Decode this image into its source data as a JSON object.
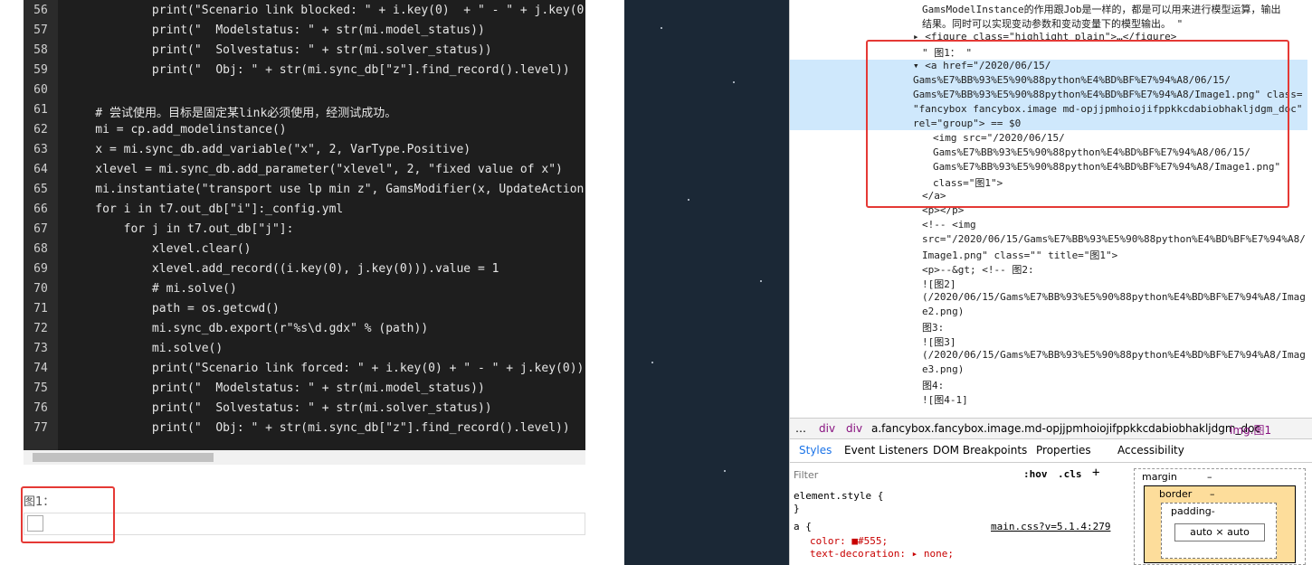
{
  "code": {
    "lines": [
      {
        "n": "56",
        "t": "            print(\"Scenario link blocked: \" + i.key(0)  + \" - \" + j.key(0"
      },
      {
        "n": "57",
        "t": "            print(\"  Modelstatus: \" + str(mi.model_status))"
      },
      {
        "n": "58",
        "t": "            print(\"  Solvestatus: \" + str(mi.solver_status))"
      },
      {
        "n": "59",
        "t": "            print(\"  Obj: \" + str(mi.sync_db[\"z\"].find_record().level))"
      },
      {
        "n": "60",
        "t": ""
      },
      {
        "n": "61",
        "t": "    # 尝试使用。目标是固定某link必须使用，经测试成功。"
      },
      {
        "n": "62",
        "t": "    mi = cp.add_modelinstance()"
      },
      {
        "n": "63",
        "t": "    x = mi.sync_db.add_variable(\"x\", 2, VarType.Positive)"
      },
      {
        "n": "64",
        "t": "    xlevel = mi.sync_db.add_parameter(\"xlevel\", 2, \"fixed value of x\")"
      },
      {
        "n": "65",
        "t": "    mi.instantiate(\"transport use lp min z\", GamsModifier(x, UpdateAction"
      },
      {
        "n": "66",
        "t": "    for i in t7.out_db[\"i\"]:_config.yml"
      },
      {
        "n": "67",
        "t": "        for j in t7.out_db[\"j\"]:"
      },
      {
        "n": "68",
        "t": "            xlevel.clear()"
      },
      {
        "n": "69",
        "t": "            xlevel.add_record((i.key(0), j.key(0))).value = 1"
      },
      {
        "n": "70",
        "t": "            # mi.solve()"
      },
      {
        "n": "71",
        "t": "            path = os.getcwd()"
      },
      {
        "n": "72",
        "t": "            mi.sync_db.export(r\"%s\\d.gdx\" % (path))"
      },
      {
        "n": "73",
        "t": "            mi.solve()"
      },
      {
        "n": "74",
        "t": "            print(\"Scenario link forced: \" + i.key(0) + \" - \" + j.key(0))"
      },
      {
        "n": "75",
        "t": "            print(\"  Modelstatus: \" + str(mi.model_status))"
      },
      {
        "n": "76",
        "t": "            print(\"  Solvestatus: \" + str(mi.solver_status))"
      },
      {
        "n": "77",
        "t": "            print(\"  Obj: \" + str(mi.sync_db[\"z\"].find_record().level))"
      }
    ]
  },
  "figure": {
    "label": "图1："
  },
  "devtools": {
    "dom_lines": [
      "GamsModelInstance的作用跟Job是一样的，都是可以用来进行模型运算，输出",
      "结果。同时可以实现变动参数和变动变量下的模型输出。 \"",
      "▸ <figure class=\"highlight plain\">…</figure>",
      "\" 图1： \"",
      "▾ <a href=\"/2020/06/15/",
      "Gams%E7%BB%93%E5%90%88python%E4%BD%BF%E7%94%A8/06/15/",
      "Gams%E7%BB%93%E5%90%88python%E4%BD%BF%E7%94%A8/Image1.png\" class=",
      "\"fancybox fancybox.image md-opjjpmhoiojifppkkcdabiobhakljdgm_doc\"",
      "rel=\"group\"> == $0",
      "<img src=\"/2020/06/15/",
      "Gams%E7%BB%93%E5%90%88python%E4%BD%BF%E7%94%A8/06/15/",
      "Gams%E7%BB%93%E5%90%88python%E4%BD%BF%E7%94%A8/Image1.png\"",
      "class=\"图1\">",
      "</a>",
      "<p></p>",
      "<!-- <img",
      "src=\"/2020/06/15/Gams%E7%BB%93%E5%90%88python%E4%BD%BF%E7%94%A8/",
      "Image1.png\" class=\"\" title=\"图1\">",
      "<p>--&gt; <!-- 图2:",
      "![图2]",
      "(/2020/06/15/Gams%E7%BB%93%E5%90%88python%E4%BD%BF%E7%94%A8/Imag",
      "e2.png)",
      "图3:",
      "![图3]",
      "(/2020/06/15/Gams%E7%BB%93%E5%90%88python%E4%BD%BF%E7%94%A8/Imag",
      "e3.png)",
      "图4:",
      "![图4-1]"
    ],
    "breadcrumb": [
      "…",
      "div",
      "div",
      "a.fancybox.fancybox.image.md-opjjpmhoiojifppkkcdabiobhakljdgm_doc",
      "img.图1"
    ],
    "tabs": [
      "Styles",
      "Event Listeners",
      "DOM Breakpoints",
      "Properties",
      "Accessibility"
    ],
    "filter_placeholder": "Filter",
    "hov": ":hov",
    "cls": ".cls",
    "plus": "+",
    "element_style": "element.style {",
    "close_brace": "}",
    "a_rule": "a {",
    "source": "main.css?v=5.1.4:279",
    "color_line": "color: ■#555;",
    "decor_line": "text-decoration: ▸ none;",
    "boxmodel": {
      "margin": "margin",
      "border": "border",
      "padding": "padding-",
      "dash": "–",
      "content": "auto × auto"
    }
  }
}
